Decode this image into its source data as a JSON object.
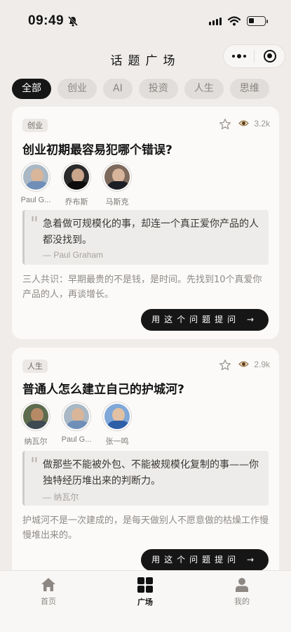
{
  "status_bar": {
    "time": "09:49"
  },
  "header": {
    "title": "话题广场"
  },
  "tabs": [
    {
      "label": "全部",
      "active": true
    },
    {
      "label": "创业",
      "active": false
    },
    {
      "label": "AI",
      "active": false
    },
    {
      "label": "投资",
      "active": false
    },
    {
      "label": "人生",
      "active": false
    },
    {
      "label": "思维",
      "active": false
    }
  ],
  "cards": [
    {
      "tag": "创业",
      "views": "3.2k",
      "title": "创业初期最容易犯哪个错误?",
      "persons": [
        {
          "name": "Paul G..."
        },
        {
          "name": "乔布斯"
        },
        {
          "name": "马斯克"
        }
      ],
      "quote": "急着做可规模化的事，却连一个真正爱你产品的人都没找到。",
      "quote_author": "— Paul Graham",
      "summary": "三人共识：早期最贵的不是钱，是时间。先找到10个真爱你产品的人，再谈增长。",
      "button_label": "用这个问题提问 →"
    },
    {
      "tag": "人生",
      "views": "2.9k",
      "title": "普通人怎么建立自己的护城河?",
      "persons": [
        {
          "name": "纳瓦尔"
        },
        {
          "name": "Paul G..."
        },
        {
          "name": "张一鸣"
        }
      ],
      "quote": "做那些不能被外包、不能被规模化复制的事——你独特经历堆出来的判断力。",
      "quote_author": "— 纳瓦尔",
      "summary": "护城河不是一次建成的，是每天做别人不愿意做的枯燥工作慢慢堆出来的。",
      "button_label": "用这个问题提问 →"
    }
  ],
  "tabbar": [
    {
      "label": "首页",
      "icon": "home-icon",
      "active": false
    },
    {
      "label": "广场",
      "icon": "grid-icon",
      "active": true
    },
    {
      "label": "我的",
      "icon": "profile-icon",
      "active": false
    }
  ],
  "colors": {
    "accent": "#161616",
    "background": "#efecea",
    "card": "#fbfaf9"
  }
}
